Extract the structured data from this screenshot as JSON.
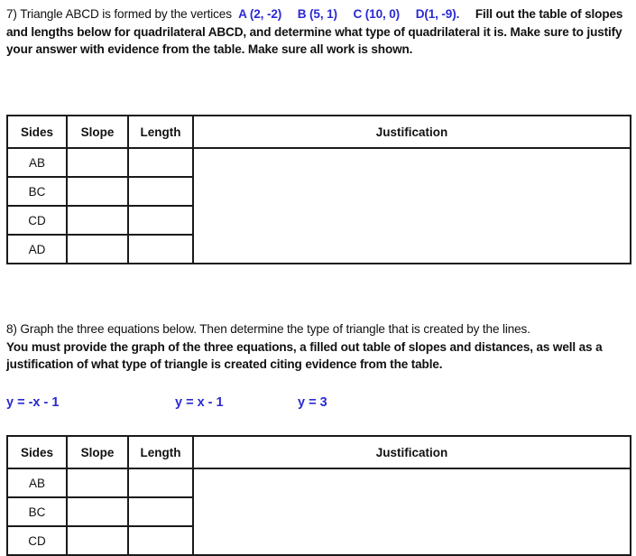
{
  "question7": {
    "number_label": "7)",
    "intro": "Triangle ABCD is formed by the vertices",
    "vertices": [
      "A (2, -2)",
      "B (5, 1)",
      "C (10, 0)",
      "D(1, -9)."
    ],
    "instructions": "Fill out the table of slopes and lengths below for quadrilateral ABCD, and determine what type of quadrilateral it is.  Make sure to justify your answer with evidence from the table.  Make sure all work is shown.",
    "table": {
      "headers": [
        "Sides",
        "Slope",
        "Length",
        "Justification"
      ],
      "rows": [
        {
          "side": "AB",
          "slope": "",
          "length": ""
        },
        {
          "side": "BC",
          "slope": "",
          "length": ""
        },
        {
          "side": "CD",
          "slope": "",
          "length": ""
        },
        {
          "side": "AD",
          "slope": "",
          "length": ""
        }
      ],
      "justification": ""
    }
  },
  "question8": {
    "intro": "8) Graph the three equations below.  Then determine the type of triangle that is created by the lines.",
    "instructions": "You must provide the graph of the three equations, a filled out table of slopes and distances, as well as a justification of what type of triangle is created citing evidence from the table.",
    "equations": [
      "y = -x - 1",
      "y = x - 1",
      "y = 3"
    ],
    "table": {
      "headers": [
        "Sides",
        "Slope",
        "Length",
        "Justification"
      ],
      "rows": [
        {
          "side": "AB",
          "slope": "",
          "length": ""
        },
        {
          "side": "BC",
          "slope": "",
          "length": ""
        },
        {
          "side": "CD",
          "slope": "",
          "length": ""
        }
      ],
      "justification": ""
    }
  },
  "colors": {
    "accent_blue": "#2a2ad4",
    "text": "#111111",
    "border": "#1a1a1a"
  }
}
